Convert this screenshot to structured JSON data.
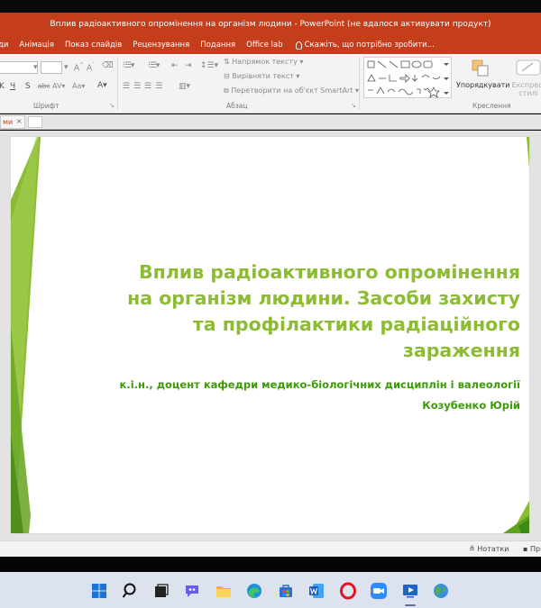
{
  "window": {
    "title": "Вплив радіоактивного опромінення на організм людини - PowerPoint (не вдалося активувати продукт)"
  },
  "menu": {
    "tabs": [
      "ди",
      "Анімація",
      "Показ слайдів",
      "Рецензування",
      "Подання",
      "Office lab"
    ],
    "tell_me": "Скажіть, що потрібно зробити..."
  },
  "ribbon": {
    "paragraph_buttons": {
      "text_direction": "Напрямок тексту",
      "align_text": "Вирівняти текст",
      "convert_smartart": "Перетворити на об'єкт SmartArt"
    },
    "arrange_label": "Упорядкувати",
    "quick_styles_label_1": "Експрес-",
    "quick_styles_label_2": "стилі",
    "groups": {
      "font": "Шрифт",
      "paragraph": "Абзац",
      "drawing": "Креслення"
    }
  },
  "pane_tab": "ми",
  "slide": {
    "title_lines": [
      "Вплив радіоактивного опромінення",
      "на організм людини. Засоби захисту",
      "та профілактики радіаційного",
      "зараження"
    ],
    "subtitle_line1": "к.і.н., доцент кафедри медико-біологічних дисциплін і валеології",
    "subtitle_line2": "Козубенко Юрій",
    "accent_color": "#8cbc33",
    "accent_dark": "#3d9a0a"
  },
  "status": {
    "notes": "Нотатки",
    "comments": "При"
  },
  "taskbar": {
    "apps": [
      "start-icon",
      "search-icon",
      "task-view-icon",
      "chat-icon",
      "file-explorer-icon",
      "edge-icon",
      "store-icon",
      "word-icon",
      "opera-icon",
      "zoom-icon",
      "powerpoint-icon",
      "globe-icon"
    ]
  }
}
